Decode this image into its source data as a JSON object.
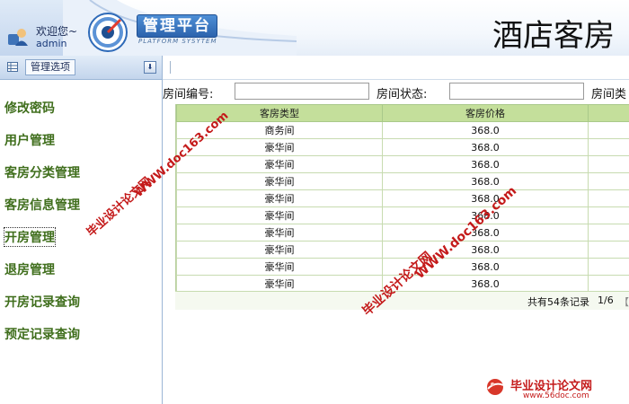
{
  "header": {
    "welcome": "欢迎您~",
    "username": "admin",
    "platform_title": "管理平台",
    "platform_subtitle": "PLATFORM SYSYTEM",
    "hotel_title": "酒店客房"
  },
  "sidebar": {
    "menu_title": "管理选项",
    "collapse_symbol": "⬇",
    "items": [
      {
        "label": "修改密码"
      },
      {
        "label": "用户管理"
      },
      {
        "label": "客房分类管理"
      },
      {
        "label": "客房信息管理"
      },
      {
        "label": "开房管理"
      },
      {
        "label": "退房管理"
      },
      {
        "label": "开房记录查询"
      },
      {
        "label": "预定记录查询"
      }
    ]
  },
  "search": {
    "room_no_label": "房间编号:",
    "room_no_value": "",
    "room_status_label": "房间状态:",
    "room_status_value": "",
    "room_type_label": "房间类"
  },
  "table": {
    "columns": [
      "客房类型",
      "客房价格"
    ],
    "rows": [
      [
        "商务间",
        "368.0"
      ],
      [
        "豪华间",
        "368.0"
      ],
      [
        "豪华间",
        "368.0"
      ],
      [
        "豪华间",
        "368.0"
      ],
      [
        "豪华间",
        "368.0"
      ],
      [
        "豪华间",
        "368.0"
      ],
      [
        "豪华间",
        "368.0"
      ],
      [
        "豪华间",
        "368.0"
      ],
      [
        "豪华间",
        "368.0"
      ],
      [
        "豪华间",
        "368.0"
      ]
    ]
  },
  "pager": {
    "summary": "共有54条记录",
    "page": "1/6",
    "nav": "【"
  },
  "watermarks": {
    "text_cn": "毕业设计论文网",
    "text_url": "WWW.doc163.com",
    "corner_main": "毕业设计论文网",
    "corner_url": "www.56doc.com"
  },
  "colors": {
    "nav_text": "#3f6e1c",
    "table_header_bg": "#c4df9b",
    "watermark": "#c41a1a",
    "platform_badge": "#2c63ad"
  }
}
